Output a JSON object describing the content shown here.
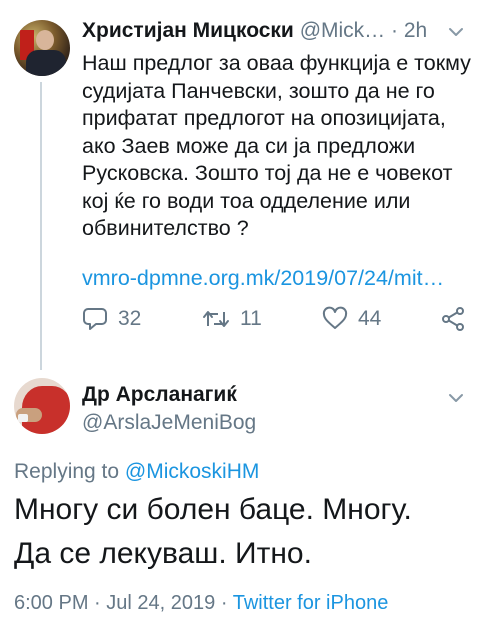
{
  "tweet1": {
    "display_name": "Христијан Мицкоски",
    "handle": "@Mick…",
    "separator": "·",
    "time": "2h",
    "text": "Наш предлог за оваа функција е токму\nсудијата Панчевски, зошто да не го\nприфатат предлогот на опозицијата,\nако Заев може да си ја предложи\nРусковска. Зошто тој да не е човекот\nкој ќе го води тоа одделение или\nобвинителство ?",
    "link": "vmro-dpmne.org.mk/2019/07/24/mit…",
    "replies": "32",
    "retweets": "11",
    "likes": "44",
    "icons": {
      "reply": "reply-icon",
      "retweet": "retweet-icon",
      "like": "heart-icon",
      "share": "share-icon",
      "menu": "chevron-down-icon"
    }
  },
  "tweet2": {
    "display_name": "Др Арсланагиќ",
    "handle": "@ArslaJeMeniBog",
    "replying_prefix": "Replying to",
    "replying_to": "@MickoskiHM",
    "text": "Многу си болен баце. Многу.\nДа се лекуваш. Итно.",
    "time": "6:00 PM",
    "sep1": "·",
    "date": "Jul 24, 2019",
    "sep2": "·",
    "source": "Twitter for iPhone"
  },
  "colors": {
    "text": "#14171a",
    "secondary": "#657786",
    "link": "#1b95e0",
    "thread_line": "#ccd6dd"
  }
}
